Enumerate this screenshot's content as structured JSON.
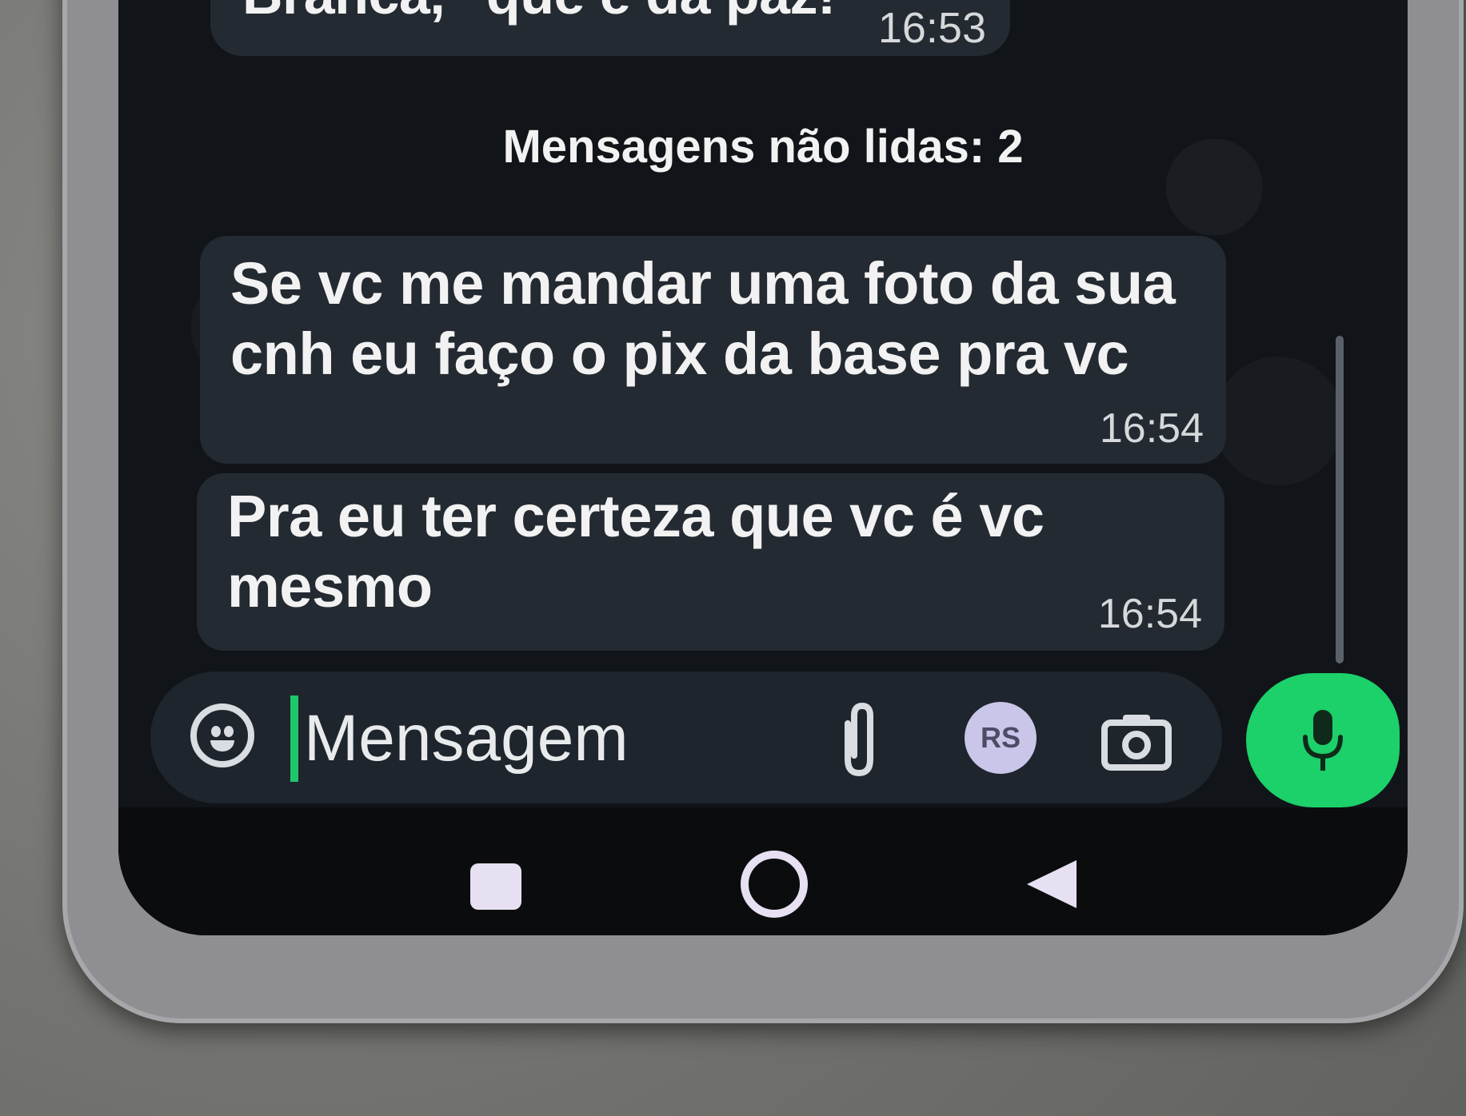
{
  "chat": {
    "previous_message": {
      "text": "Branca, \"que é da paz!",
      "time": "16:53"
    },
    "unread_divider": "Mensagens não lidas: 2",
    "messages": [
      {
        "text": "Se vc me mandar uma foto da sua cnh eu faço o pix da base pra vc",
        "time": "16:54"
      },
      {
        "text": "Pra eu ter certeza que vc é vc mesmo",
        "time": "16:54"
      }
    ]
  },
  "composer": {
    "placeholder": "Mensagem",
    "emoji_icon": "emoji-icon",
    "attach_icon": "paperclip-icon",
    "payment_badge": "RS",
    "camera_icon": "camera-icon",
    "mic_icon": "microphone-icon",
    "accent_color": "#1cd06a"
  },
  "navigation": {
    "recents_icon": "square-icon",
    "home_icon": "circle-icon",
    "back_icon": "triangle-back-icon"
  }
}
